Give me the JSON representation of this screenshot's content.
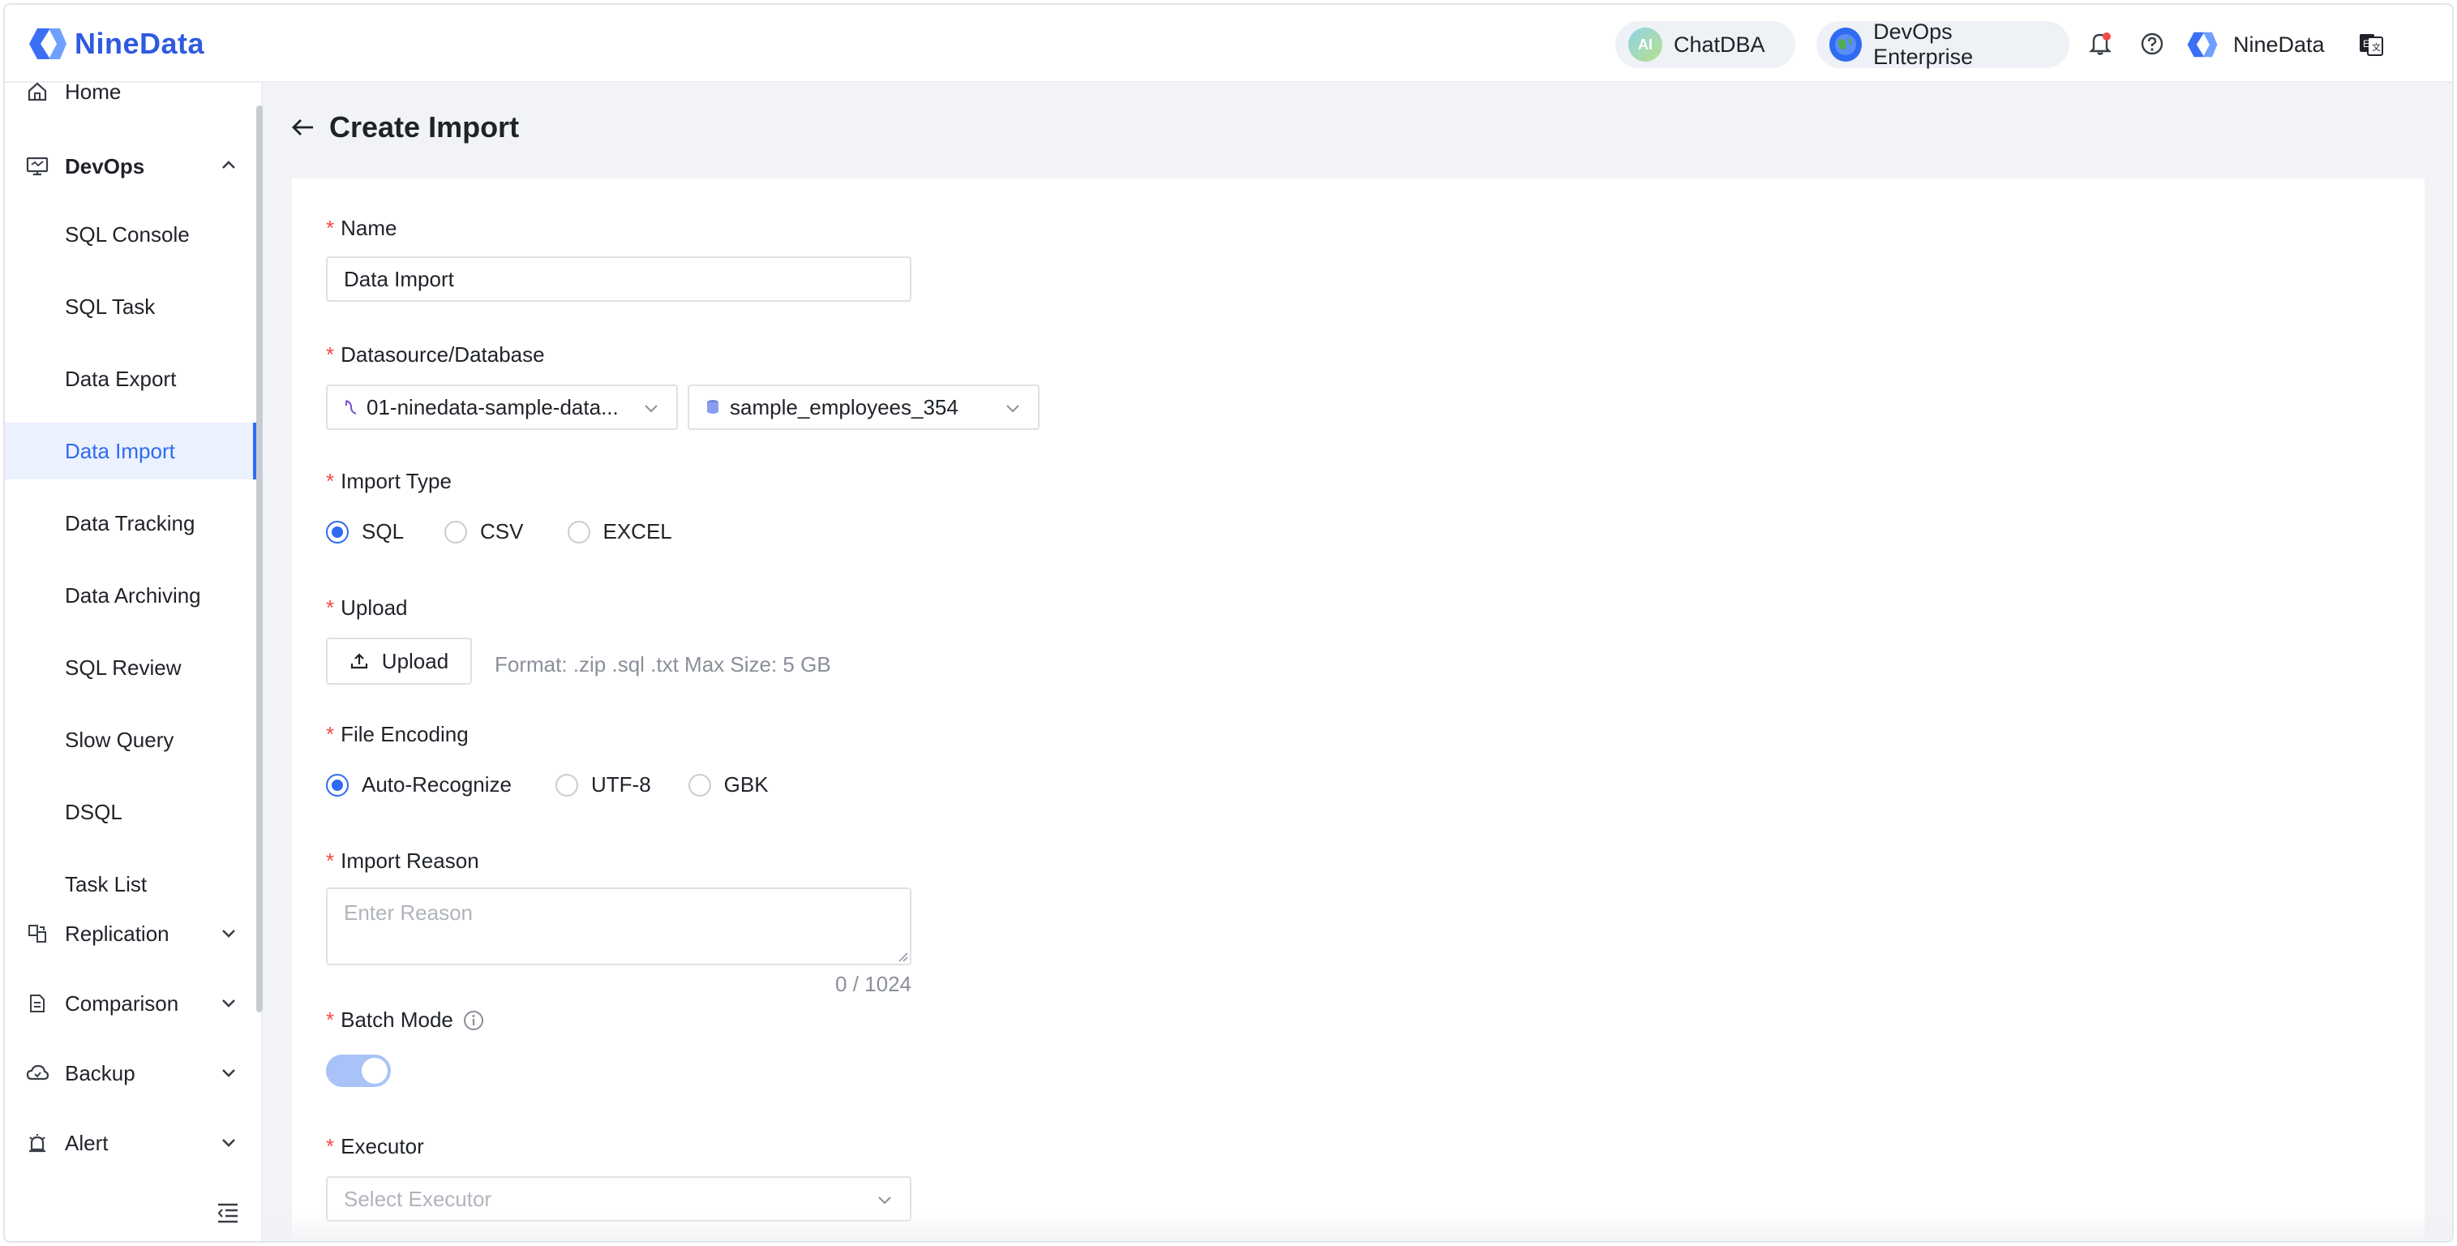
{
  "header": {
    "brand": "NineData",
    "chatdba_label": "ChatDBA",
    "chatdba_badge": "AI",
    "plan_label": "DevOps Enterprise",
    "user_label": "NineData",
    "icons": [
      "bell-icon",
      "help-icon",
      "language-icon"
    ]
  },
  "sidebar": {
    "home": "Home",
    "devops": "DevOps",
    "devops_items": [
      {
        "label": "SQL Console"
      },
      {
        "label": "SQL Task"
      },
      {
        "label": "Data Export"
      },
      {
        "label": "Data Import",
        "active": true
      },
      {
        "label": "Data Tracking"
      },
      {
        "label": "Data Archiving"
      },
      {
        "label": "SQL Review"
      },
      {
        "label": "Slow Query"
      },
      {
        "label": "DSQL"
      },
      {
        "label": "Task List"
      }
    ],
    "replication": "Replication",
    "comparison": "Comparison",
    "backup": "Backup",
    "alert": "Alert"
  },
  "page": {
    "title": "Create Import"
  },
  "form": {
    "required_mark": "*",
    "name_label": "Name",
    "name_value": "Data Import",
    "datasource_label": "Datasource/Database",
    "datasource_value": "01-ninedata-sample-data...",
    "database_value": "sample_employees_354",
    "import_type_label": "Import Type",
    "import_type_options": [
      "SQL",
      "CSV",
      "EXCEL"
    ],
    "import_type_selected": "SQL",
    "upload_label": "Upload",
    "upload_button": "Upload",
    "upload_hint": "Format: .zip .sql .txt Max Size: 5 GB",
    "encoding_label": "File Encoding",
    "encoding_options": [
      "Auto-Recognize",
      "UTF-8",
      "GBK"
    ],
    "encoding_selected": "Auto-Recognize",
    "reason_label": "Import Reason",
    "reason_placeholder": "Enter Reason",
    "reason_count": "0 / 1024",
    "batch_label": "Batch Mode",
    "batch_mode_on": true,
    "executor_label": "Executor",
    "executor_placeholder": "Select Executor"
  },
  "colors": {
    "accent": "#2f6bf1",
    "required": "#f54a45",
    "brand": "#2f5ae0"
  }
}
